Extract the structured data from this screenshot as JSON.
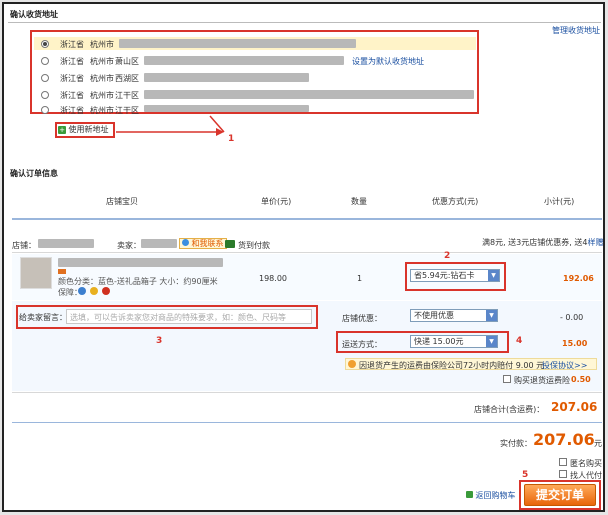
{
  "address_section": {
    "title": "确认收货地址",
    "manage_link": "管理收货地址",
    "set_default_link": "设置为默认收货地址",
    "add_address_button": "使用新地址",
    "addresses": [
      {
        "province": "浙江省",
        "city": "杭州市",
        "district": "",
        "selected": true
      },
      {
        "province": "浙江省",
        "city": "杭州市",
        "district": "萧山区",
        "selected": false
      },
      {
        "province": "浙江省",
        "city": "杭州市",
        "district": "西湖区",
        "selected": false
      },
      {
        "province": "浙江省",
        "city": "杭州市",
        "district": "江干区",
        "selected": false
      },
      {
        "province": "浙江省",
        "city": "杭州市",
        "district": "江干区",
        "selected": false
      }
    ]
  },
  "order_section": {
    "title": "确认订单信息",
    "columns": [
      "店铺宝贝",
      "单价(元)",
      "数量",
      "优惠方式(元)",
      "小计(元)"
    ],
    "shop_label": "店铺：",
    "seller_label": "卖家：",
    "contact_label": "和我联系",
    "pay_on_delivery": "货到付款",
    "promo_text": "满8元, 送3元店铺优惠券, 送4",
    "promo_link": "样赠品",
    "item": {
      "color_label": "颜色分类：蓝色-送礼品箱子  大小：约90厘米",
      "guarantee_label": "保障：",
      "price": "198.00",
      "qty": "1",
      "discount_option": "省5.94元:钻石卡",
      "subtotal": "192.06"
    },
    "message_label": "给卖家留言：",
    "message_placeholder": "选填，可以告诉卖家您对商品的特殊要求，如：颜色、尺码等",
    "shop_discount_label": "店铺优惠：",
    "shop_discount_option": "不使用优惠",
    "shop_discount_value": "- 0.00",
    "shipping_label": "运送方式：",
    "shipping_option": "快递 15.00元",
    "shipping_value": "15.00",
    "insurance_text": "因退货产生的运费由保险公司72小时内赔付  9.00 元",
    "insurance_link": "投保协议>>",
    "insurance_checkbox_label": "购买退货运费险",
    "insurance_price": "0.50",
    "shop_total_label": "店铺合计(含运费)：",
    "shop_total_value": "207.06"
  },
  "payment": {
    "actual_label": "实付款：",
    "actual_value": "207.06",
    "actual_unit": "元",
    "anonymous_label": "匿名购买",
    "proxy_label": "找人代付",
    "back_link": "返回购物车",
    "submit_label": "提交订单"
  },
  "annotations": [
    "1",
    "2",
    "3",
    "4",
    "5"
  ]
}
